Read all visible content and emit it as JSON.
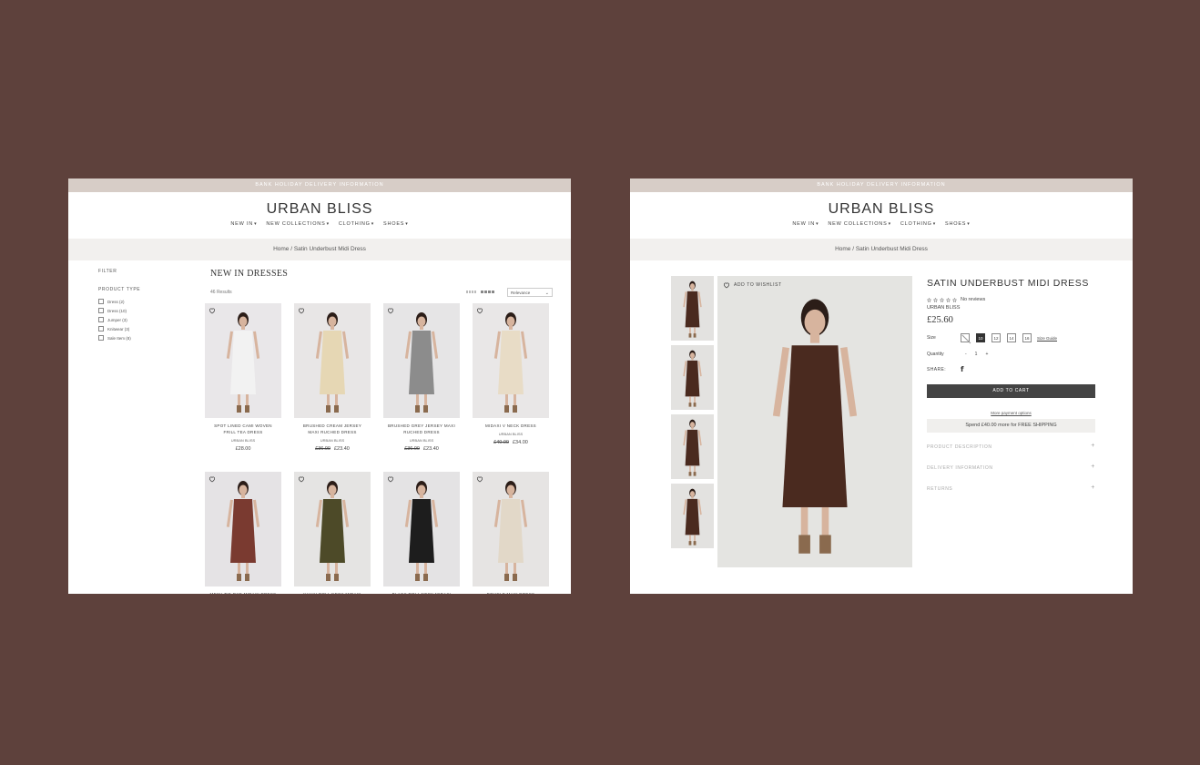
{
  "store": {
    "announcement": "BANK HOLIDAY DELIVERY INFORMATION",
    "logo": "URBAN BLISS",
    "nav": [
      "NEW IN",
      "NEW COLLECTIONS",
      "CLOTHING",
      "SHOES"
    ],
    "breadcrumb": "Home / Satin Underbust Midi Dress"
  },
  "listing": {
    "filter_label": "FILTER",
    "product_type_label": "PRODUCT TYPE",
    "filters": [
      "Dress (2)",
      "Dress (10)",
      "Jumper (3)",
      "Knitwear (3)",
      "Sale Item (8)"
    ],
    "title": "NEW IN DRESSES",
    "results": "46 Results",
    "sort": "Relevance",
    "products": [
      {
        "name": "SPOT LINED CAMI WOVEN FRILL TEA DRESS",
        "brand": "URBAN BLISS",
        "was": "",
        "price": "£28.00",
        "dress": "#f2f2f2",
        "bg": "#e9e7e9"
      },
      {
        "name": "BRUSHED CREAM JERSEY MAXI RUCHED DRESS",
        "brand": "URBAN BLISS",
        "was": "£36.00",
        "price": "£23.40",
        "dress": "#e6d7b4",
        "bg": "#e8e6e6"
      },
      {
        "name": "BRUSHED GREY JERSEY MAXI RUCHED DRESS",
        "brand": "URBAN BLISS",
        "was": "£36.00",
        "price": "£23.40",
        "dress": "#8c8c8c",
        "bg": "#e6e5e6"
      },
      {
        "name": "MIDAXI V NECK DRESS",
        "brand": "URBAN BLISS",
        "was": "£40.00",
        "price": "£34.00",
        "dress": "#e8dcc6",
        "bg": "#e9e7e7"
      },
      {
        "name": "MESH TIE-DYE MIDAXI DRESS",
        "brand": "",
        "was": "",
        "price": "",
        "dress": "#7a3a30",
        "bg": "#e5e3e5"
      },
      {
        "name": "KHAKI ROLL NECK MIDAXI DRESS",
        "brand": "",
        "was": "",
        "price": "",
        "dress": "#4d4a28",
        "bg": "#e5e4e3"
      },
      {
        "name": "BLACK ROLL NECK MIDAXI DRESS",
        "brand": "",
        "was": "",
        "price": "",
        "dress": "#1d1d1d",
        "bg": "#e4e3e4"
      },
      {
        "name": "BOUCLE MAXI DRESS",
        "brand": "",
        "was": "",
        "price": "",
        "dress": "#e2d8c8",
        "bg": "#e6e4e3"
      }
    ]
  },
  "product": {
    "wishlist": "ADD TO WISHLIST",
    "title": "SATIN UNDERBUST MIDI DRESS",
    "rating_text": "No reviews",
    "brand": "URBAN BLISS",
    "price": "£25.60",
    "size_label": "Size",
    "sizes": [
      "8",
      "10",
      "12",
      "14",
      "16"
    ],
    "size_selected": "10",
    "size_guide": "Size Guide",
    "quantity_label": "Quantity",
    "qty_minus": "-",
    "qty_value": "1",
    "qty_plus": "+",
    "share_label": "SHARE:",
    "add_to_cart": "ADD TO CART",
    "more_payment": "More payment options",
    "shipping": "Spend £40.00 more for FREE SHIPPING",
    "accordions": [
      "PRODUCT DESCRIPTION",
      "DELIVERY INFORMATION",
      "RETURNS"
    ],
    "dress_color": "#4a2a1f"
  }
}
